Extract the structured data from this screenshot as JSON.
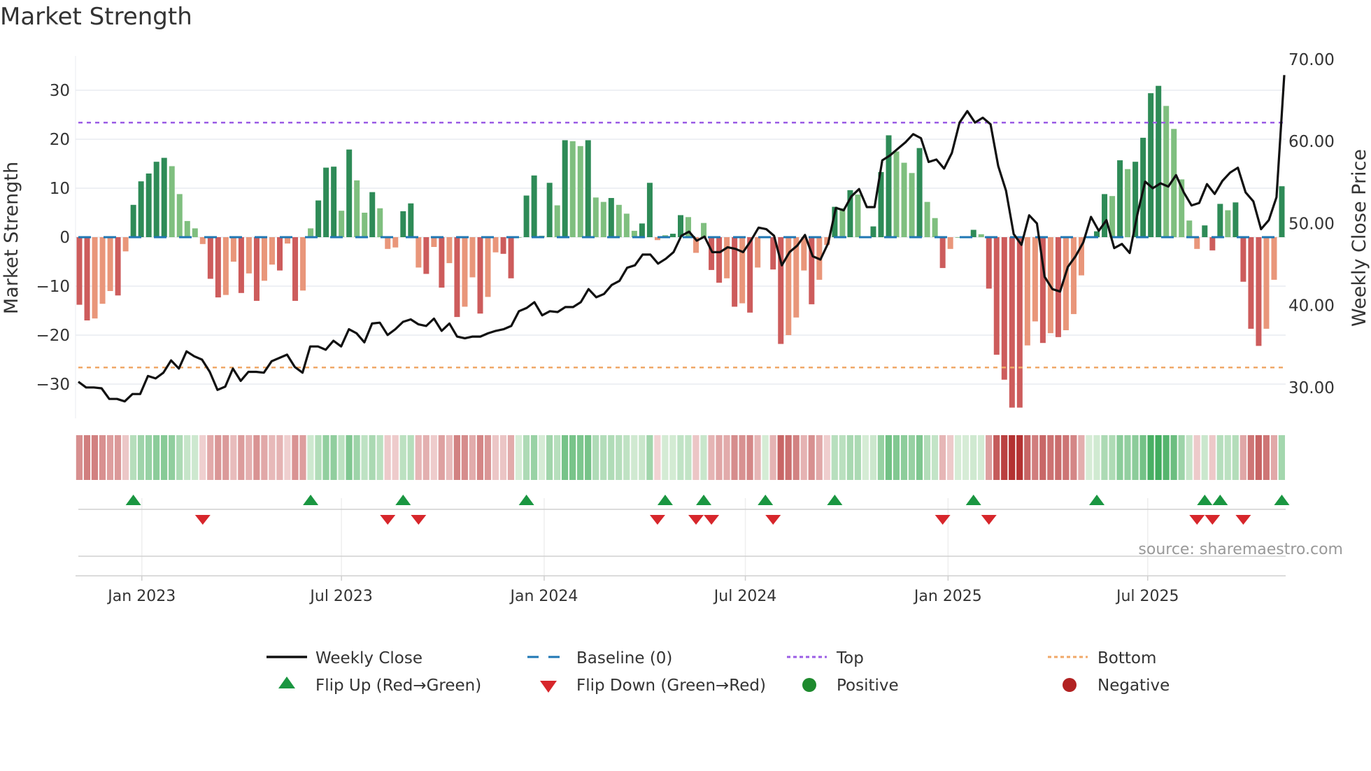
{
  "title": "Market Strength",
  "source": "source: sharemaestro.com",
  "colors": {
    "strong_pos": "#2e8b57",
    "weak_pos": "#7fbf7f",
    "strong_neg": "#cd5c5c",
    "weak_neg": "#e9967a",
    "close": "#111111",
    "baseline": "#1f77b4",
    "top": "#9b5de5",
    "bottom": "#f0a868",
    "flip_up": "#1a9641",
    "flip_down": "#d7262b",
    "positive": "#1e8a2e",
    "negative": "#b22222"
  },
  "legend": {
    "close": "Weekly Close",
    "baseline": "Baseline (0)",
    "top": "Top",
    "bottom": "Bottom",
    "flip_up": "Flip Up (Red→Green)",
    "flip_down": "Flip Down (Green→Red)",
    "positive": "Positive",
    "negative": "Negative"
  },
  "chart_data": {
    "type": "bar",
    "title": "Market Strength",
    "ylabel": "Market Strength",
    "y2label": "Weekly Close Price",
    "ylim": [
      -37,
      37
    ],
    "y2lim": [
      26.5,
      71
    ],
    "yticks": [
      "30",
      "20",
      "10",
      "0",
      "−10",
      "−20",
      "−30"
    ],
    "ytick_values": [
      30,
      20,
      10,
      0,
      -10,
      -20,
      -30
    ],
    "y2ticks": [
      "70.00",
      "60.00",
      "50.00",
      "40.00",
      "30.00"
    ],
    "y2tick_values": [
      70,
      60,
      50,
      40,
      30
    ],
    "xticks": [
      "Jan 2023",
      "Jul 2023",
      "Jan 2024",
      "Jul 2024",
      "Jan 2025",
      "Jul 2025"
    ],
    "xtick_week_index": [
      8.6,
      34.5,
      60.8,
      86.9,
      113.2,
      139.1
    ],
    "top_level": 23.4,
    "bottom_level": -26.6,
    "baseline": 0,
    "strength": [
      -13.8,
      -17,
      -16.6,
      -13.6,
      -11,
      -11.9,
      -2.9,
      6.6,
      11.4,
      13,
      15.4,
      16.2,
      14.5,
      8.8,
      3.3,
      1.8,
      -1.4,
      -8.5,
      -12.3,
      -11.8,
      -5,
      -11.4,
      -7.4,
      -13,
      -8.9,
      -5.6,
      -6.8,
      -1.3,
      -13,
      -10.9,
      1.8,
      7.5,
      14.2,
      14.4,
      5.4,
      17.9,
      11.6,
      5,
      9.2,
      5.9,
      -2.4,
      -2.1,
      5.3,
      6.9,
      -6.2,
      -7.5,
      -2,
      -10.3,
      -5.3,
      -16.3,
      -14.2,
      -8.2,
      -15.6,
      -12.2,
      -3.1,
      -3.4,
      -8.4,
      0,
      8.5,
      12.6,
      0.3,
      11.1,
      6.5,
      19.8,
      19.6,
      18.6,
      19.8,
      8.1,
      7.2,
      8,
      6.6,
      4.8,
      1.3,
      2.8,
      11.1,
      -0.6,
      0.4,
      0.7,
      4.5,
      4.1,
      -3.2,
      2.9,
      -6.7,
      -9.3,
      -8.4,
      -14.2,
      -13.5,
      -15.4,
      -6.2,
      0.2,
      -6.6,
      -21.8,
      -20,
      -16.4,
      -6.8,
      -13.7,
      -8.7,
      -1.6,
      6.2,
      5.9,
      9.6,
      8.7,
      0.2,
      2.2,
      13.3,
      20.8,
      17.5,
      15.2,
      13.1,
      18.2,
      7.2,
      3.9,
      -6.3,
      -2.4,
      0,
      0,
      1.5,
      0.6,
      -10.5,
      -24,
      -29.1,
      -34.8,
      -34.8,
      -22.1,
      -17.2,
      -21.6,
      -19.6,
      -20.4,
      -19,
      -15.7,
      -7.8,
      0,
      1.2,
      8.8,
      8.4,
      15.7,
      13.9,
      15.4,
      20.3,
      29.4,
      30.9,
      26.8,
      22.1,
      11.8,
      3.4,
      -2.4,
      2.4,
      -2.7,
      6.8,
      5.5,
      7.1,
      -9.1,
      -18.7,
      -22.2,
      -18.7,
      -8.7,
      10.4
    ],
    "weekly_close": [
      30.7,
      30.0,
      30.0,
      29.9,
      28.6,
      28.6,
      28.3,
      29.2,
      29.2,
      31.4,
      31.1,
      31.8,
      33.3,
      32.3,
      34.4,
      33.8,
      33.4,
      31.9,
      29.7,
      30.1,
      32.3,
      30.8,
      31.9,
      31.9,
      31.8,
      33.2,
      33.6,
      34.0,
      32.5,
      31.8,
      35.0,
      35.0,
      34.6,
      35.7,
      35.0,
      37.1,
      36.6,
      35.5,
      37.8,
      37.9,
      36.4,
      37.1,
      38.0,
      38.3,
      37.7,
      37.5,
      38.4,
      36.9,
      37.8,
      36.2,
      36.0,
      36.2,
      36.2,
      36.6,
      36.9,
      37.1,
      37.5,
      39.3,
      39.7,
      40.4,
      38.8,
      39.3,
      39.2,
      39.8,
      39.8,
      40.4,
      42.0,
      41.0,
      41.4,
      42.5,
      43.0,
      44.6,
      44.9,
      46.2,
      46.2,
      45.1,
      45.7,
      46.5,
      48.5,
      49.0,
      47.9,
      48.4,
      46.5,
      46.5,
      47.1,
      46.9,
      46.5,
      47.9,
      49.5,
      49.3,
      48.5,
      44.9,
      46.5,
      47.3,
      48.6,
      46.0,
      45.6,
      47.6,
      51.9,
      51.6,
      53.3,
      54.2,
      52.0,
      52.0,
      57.7,
      58.3,
      59.1,
      59.9,
      60.9,
      60.4,
      57.5,
      57.8,
      56.7,
      58.6,
      62.3,
      63.7,
      62.3,
      62.9,
      62.1,
      57.0,
      54.0,
      48.7,
      47.4,
      51.0,
      50.0,
      43.5,
      42.0,
      41.7,
      44.7,
      46.0,
      47.7,
      50.8,
      49.1,
      50.4,
      47.0,
      47.5,
      46.4,
      51.1,
      55.1,
      54.3,
      54.9,
      54.5,
      55.9,
      53.8,
      52.2,
      52.5,
      54.8,
      53.6,
      55.2,
      56.2,
      56.8,
      53.8,
      52.7,
      49.3,
      50.4,
      53.2,
      68.1
    ]
  }
}
